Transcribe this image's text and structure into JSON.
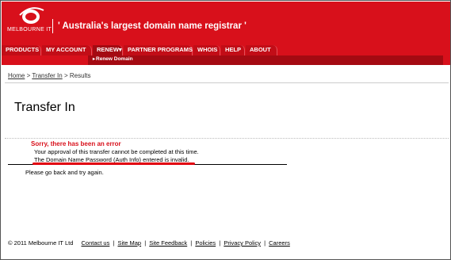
{
  "header": {
    "logo_text": "MELBOURNE IT",
    "tagline": "' Australia's largest domain name registrar '"
  },
  "nav": {
    "items": [
      {
        "label": "PRODUCTS"
      },
      {
        "label": "MY ACCOUNT"
      },
      {
        "label": "RENEW▾"
      },
      {
        "label": "PARTNER PROGRAMS"
      },
      {
        "label": "WHOIS"
      },
      {
        "label": "HELP"
      },
      {
        "label": "ABOUT"
      }
    ],
    "sub_item": "Renew Domain"
  },
  "breadcrumb": {
    "home": "Home",
    "sep1": " > ",
    "transfer": "Transfer In",
    "sep2": " > ",
    "current": "Results"
  },
  "page": {
    "title": "Transfer In"
  },
  "error": {
    "title": "Sorry, there has been an error",
    "line1": "Your approval of this transfer cannot be completed at this time.",
    "line2": "The Domain Name Password (Auth Info) entered is invalid.",
    "retry": "Please go back and try again."
  },
  "footer": {
    "copyright": "© 2011 Melbourne IT Ltd",
    "links": [
      "Contact us",
      "Site Map",
      "Site Feedback",
      "Policies",
      "Privacy Policy",
      "Careers"
    ],
    "separator": "|"
  },
  "colors": {
    "brand_red": "#d8101b",
    "nav_dark": "#a40a12",
    "error_red": "#d8101b",
    "highlight_red": "#e1000f"
  }
}
